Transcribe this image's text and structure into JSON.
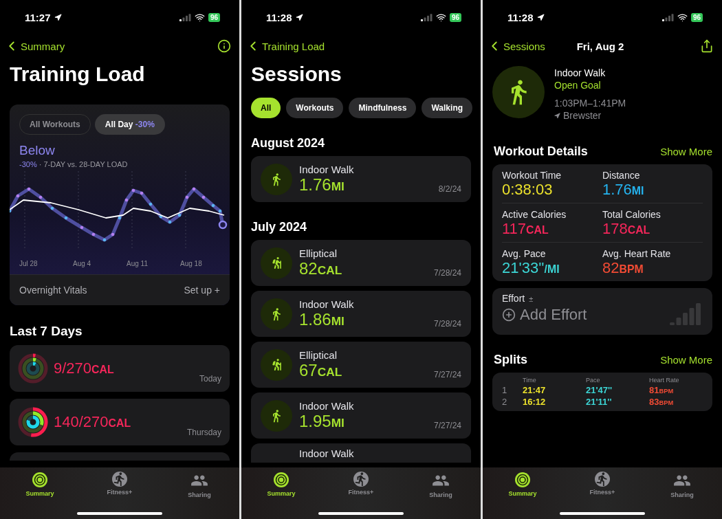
{
  "screens": [
    {
      "kind": "training_load",
      "status_bar": {
        "time": "11:27",
        "battery": "96"
      },
      "nav": {
        "back": "Summary"
      },
      "title": "Training Load",
      "load_card": {
        "segments": [
          {
            "label": "All Workouts",
            "selected": false
          },
          {
            "label": "All Day",
            "delta": "-30%",
            "selected": true
          }
        ],
        "status": "Below",
        "delta": "-30%",
        "caption": "· 7-DAY vs. 28-DAY LOAD",
        "x_labels": [
          "Jul 28",
          "Aug 4",
          "Aug 11",
          "Aug 18"
        ],
        "footer_label": "Overnight Vitals",
        "footer_action": "Set up +"
      },
      "section": "Last 7 Days",
      "days": [
        {
          "value": "9/270",
          "unit": "CAL",
          "day": "Today",
          "rings": [
            {
              "color": "#fa1e4e",
              "level": 0.03
            },
            {
              "color": "#92e82a",
              "level": 0.05
            },
            {
              "color": "#1ed8ea",
              "level": 0.08
            }
          ]
        },
        {
          "value": "140/270",
          "unit": "CAL",
          "day": "Thursday",
          "rings": [
            {
              "color": "#fa1e4e",
              "level": 0.52
            },
            {
              "color": "#92e82a",
              "level": 0.3
            },
            {
              "color": "#1ed8ea",
              "level": 0.8
            }
          ]
        }
      ],
      "tabs": [
        {
          "label": "Summary",
          "selected": true
        },
        {
          "label": "Fitness+",
          "selected": false
        },
        {
          "label": "Sharing",
          "selected": false
        }
      ]
    },
    {
      "kind": "sessions",
      "status_bar": {
        "time": "11:28",
        "battery": "96"
      },
      "nav": {
        "back": "Training Load"
      },
      "title": "Sessions",
      "filters": [
        {
          "label": "All",
          "selected": true
        },
        {
          "label": "Workouts",
          "selected": false
        },
        {
          "label": "Mindfulness",
          "selected": false
        },
        {
          "label": "Walking",
          "selected": false
        }
      ],
      "groups": [
        {
          "heading": "August 2024",
          "sessions": [
            {
              "kind": "walk",
              "name": "Indoor Walk",
              "value": "1.76",
              "unit": "MI",
              "date": "8/2/24"
            }
          ]
        },
        {
          "heading": "July 2024",
          "sessions": [
            {
              "kind": "elliptical",
              "name": "Elliptical",
              "value": "82",
              "unit": "CAL",
              "date": "7/28/24"
            },
            {
              "kind": "walk",
              "name": "Indoor Walk",
              "value": "1.86",
              "unit": "MI",
              "date": "7/28/24"
            },
            {
              "kind": "elliptical",
              "name": "Elliptical",
              "value": "67",
              "unit": "CAL",
              "date": "7/27/24"
            },
            {
              "kind": "walk",
              "name": "Indoor Walk",
              "value": "1.95",
              "unit": "MI",
              "date": "7/27/24"
            },
            {
              "name": "Indoor Walk"
            }
          ]
        }
      ],
      "tabs": [
        {
          "label": "Summary",
          "selected": true
        },
        {
          "label": "Fitness+",
          "selected": false
        },
        {
          "label": "Sharing",
          "selected": false
        }
      ]
    },
    {
      "kind": "workout",
      "status_bar": {
        "time": "11:28",
        "battery": "96"
      },
      "nav": {
        "back": "Sessions",
        "title": "Fri, Aug 2"
      },
      "workout": {
        "name": "Indoor Walk",
        "goal": "Open Goal",
        "time": "1:03PM–1:41PM",
        "location": "Brewster"
      },
      "details": {
        "heading": "Workout Details",
        "action": "Show More",
        "metrics": [
          {
            "label": "Workout Time",
            "value": "0:38:03",
            "color": "#ece22c"
          },
          {
            "label": "Distance",
            "value": "1.76",
            "unit": "MI",
            "color": "#25b4f0"
          },
          {
            "label": "Active Calories",
            "value": "117",
            "unit": "CAL",
            "color": "#f5265a"
          },
          {
            "label": "Total Calories",
            "value": "178",
            "unit": "CAL",
            "color": "#f5265a"
          },
          {
            "label": "Avg. Pace",
            "value": "21'33''",
            "unit": "/MI",
            "color": "#3cd6d6"
          },
          {
            "label": "Avg. Heart Rate",
            "value": "82",
            "unit": "BPM",
            "color": "#f24b34"
          }
        ]
      },
      "effort": {
        "label": "Effort",
        "mark": "±",
        "action": "Add Effort"
      },
      "splits": {
        "heading": "Splits",
        "action": "Show More",
        "columns": [
          "Time",
          "Pace",
          "Heart Rate"
        ],
        "rows": [
          {
            "index": "1",
            "time": "21:47",
            "pace": "21'47''",
            "heart_rate": "81",
            "unit": "BPM"
          },
          {
            "index": "2",
            "time": "16:12",
            "pace": "21'11''",
            "heart_rate": "83",
            "unit": "BPM"
          }
        ]
      },
      "tabs": [
        {
          "label": "Summary",
          "selected": true
        },
        {
          "label": "Fitness+",
          "selected": false
        },
        {
          "label": "Sharing",
          "selected": false
        }
      ]
    }
  ]
}
